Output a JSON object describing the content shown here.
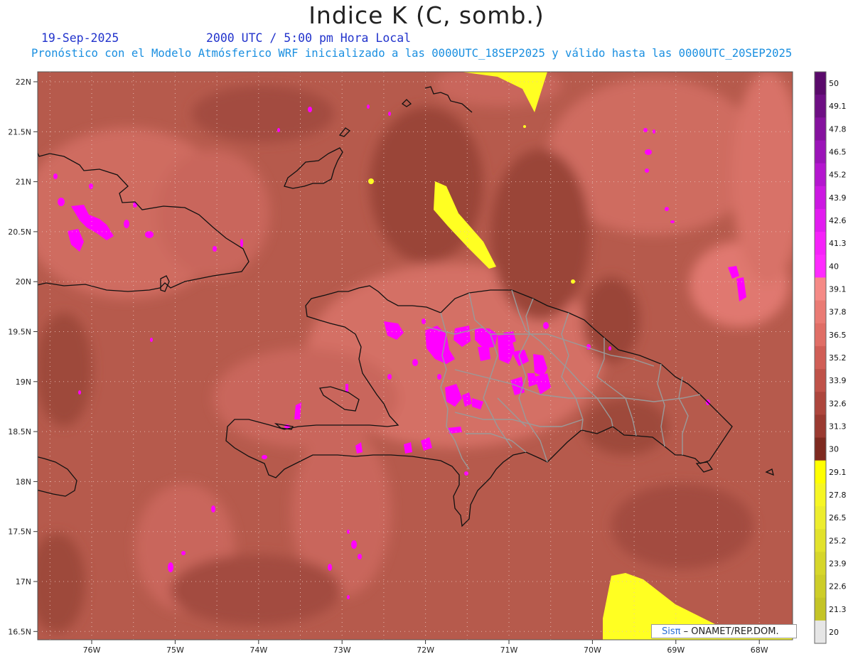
{
  "title": "Indice K (C, somb.)",
  "date": "19-Sep-2025",
  "valid_time": "2000 UTC / 5:00 pm Hora Local",
  "description": "Pronóstico con el Modelo Atmósferico WRF inicializado a las 0000UTC_18SEP2025 y válido hasta las  0000UTC_20SEP2025",
  "credit": {
    "logo": "Sisπ",
    "text": " – ONAMET/REP.DOM."
  },
  "lat_labels": [
    "22N",
    "21.5N",
    "21N",
    "20.5N",
    "20N",
    "19.5N",
    "19N",
    "18.5N",
    "18N",
    "17.5N",
    "17N",
    "16.5N"
  ],
  "lon_labels": [
    "76W",
    "75W",
    "74W",
    "73W",
    "72W",
    "71W",
    "70W",
    "69W",
    "68W"
  ],
  "colorbar": {
    "labels": [
      "50",
      "49.1",
      "47.8",
      "46.5",
      "45.2",
      "43.9",
      "42.6",
      "41.3",
      "40",
      "39.1",
      "37.8",
      "36.5",
      "35.2",
      "33.9",
      "32.6",
      "31.3",
      "30",
      "29.1",
      "27.8",
      "26.5",
      "25.2",
      "23.9",
      "22.6",
      "21.3",
      "20"
    ],
    "colors": [
      "#5a0a6b",
      "#6e0f84",
      "#85129e",
      "#9b14b8",
      "#b416cf",
      "#cc18e2",
      "#e21cf0",
      "#f622fa",
      "#ff2aff",
      "#f58a86",
      "#ea7b74",
      "#e06e66",
      "#d05e56",
      "#bf5249",
      "#ad463d",
      "#9a3a31",
      "#7e2a20",
      "#ffff00",
      "#f6f624",
      "#eded2e",
      "#e2e22c",
      "#d6d62a",
      "#cdcd28",
      "#c4c426",
      "#e6e6e6"
    ]
  },
  "field_colors": {
    "base": "#b65a4c",
    "low": "#9a4538",
    "mid": "#cf6c61",
    "high": "#e67e75",
    "magenta": "#ff00ff",
    "yellow": "#ffff22"
  },
  "labels_text": [
    "Sisπ"
  ]
}
